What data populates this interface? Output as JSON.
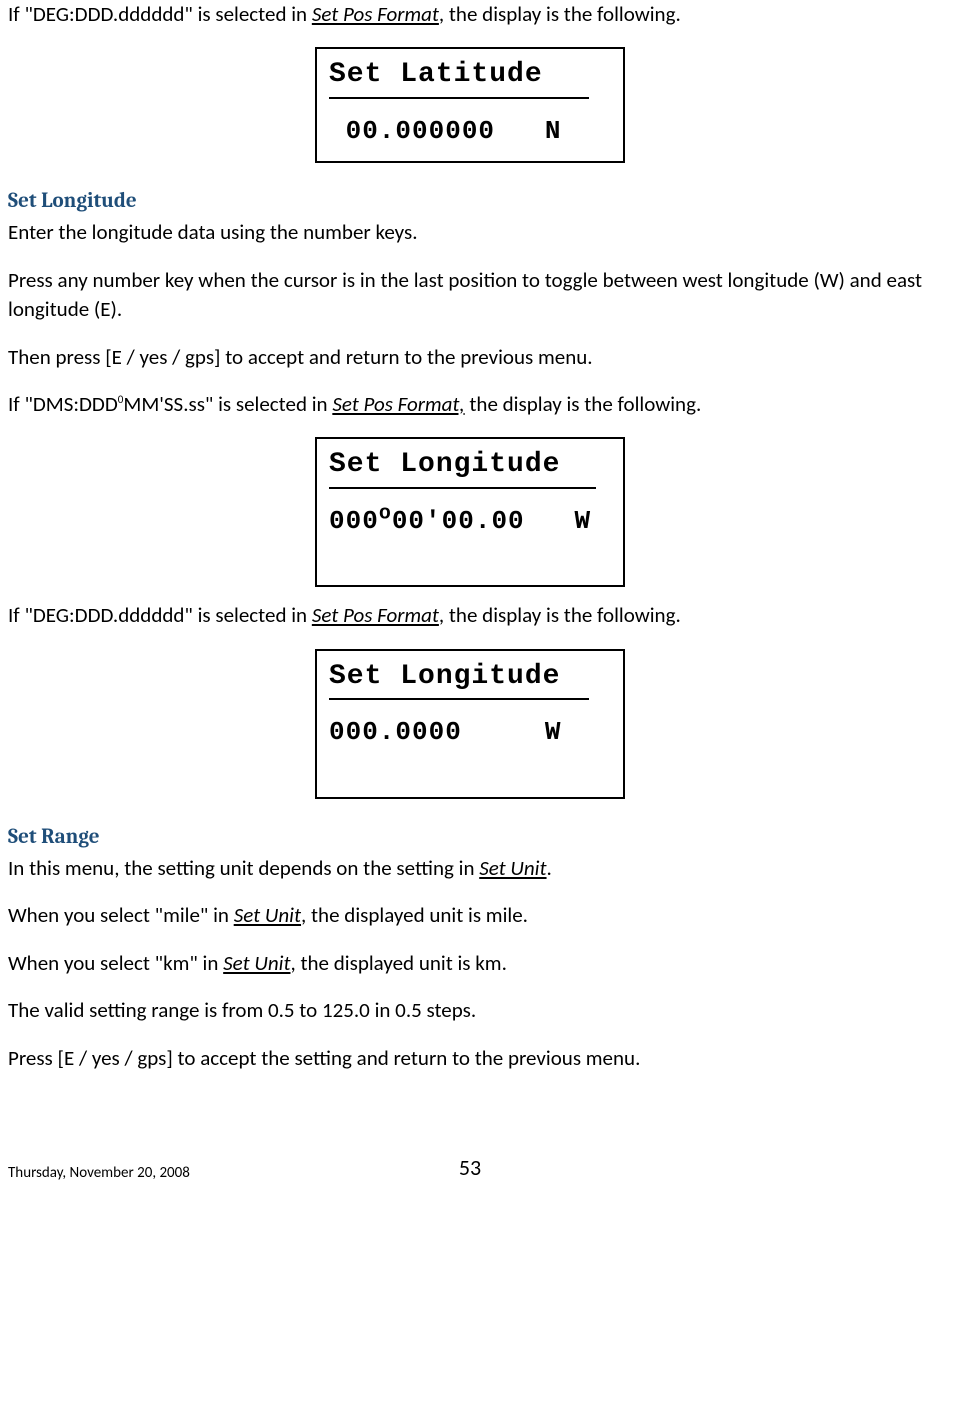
{
  "intro": {
    "p1_pre": "If \"DEG:DDD.dddddd\" is selected in ",
    "p1_link": "Set Pos Format",
    "p1_post": ", the display is the following."
  },
  "lcd1": {
    "title": "Set Latitude ",
    "line": " 00.000000   N"
  },
  "setLongitude": {
    "heading": "Set Longitude",
    "p1": "Enter the longitude data using the number keys.",
    "p2": "Press any number key when the cursor is in the last position to toggle between west longitude (W) and east longitude (E).",
    "p3": "Then press [E / yes / gps] to accept and return to the previous menu.",
    "p4_pre": "If \"DMS:DDD",
    "p4_sup": "0",
    "p4_mid": "MM'SS.ss\" is selected in ",
    "p4_link": "Set Pos Format,",
    "p4_post": " the display is the following."
  },
  "lcd2": {
    "title": "Set Longitude  ",
    "line_a": "000",
    "line_deg": "o",
    "line_b": "00'00.00   W"
  },
  "mid": {
    "p1_pre": "If \"DEG:DDD.dddddd\" is selected in ",
    "p1_link": "Set Pos Format",
    "p1_post": ", the display is the following."
  },
  "lcd3": {
    "title": "Set Longitude ",
    "line": "000.0000     W"
  },
  "setRange": {
    "heading": "Set Range",
    "p1_pre": "In this menu, the setting unit depends on the setting in ",
    "p1_link": "Set Unit",
    "p1_post": ".",
    "p2_pre": "When you select \"mile\" in ",
    "p2_link": "Set Unit",
    "p2_post": ", the displayed unit is mile.",
    "p3_pre": "When you select \"km\" in ",
    "p3_link": "Set Unit",
    "p3_post": ", the displayed unit is km.",
    "p4": "The valid setting range is from 0.5 to 125.0 in 0.5 steps.",
    "p5": "Press [E / yes / gps] to accept the setting and return to the previous menu."
  },
  "footer": {
    "date": "Thursday, November 20, 2008",
    "page": "53"
  }
}
